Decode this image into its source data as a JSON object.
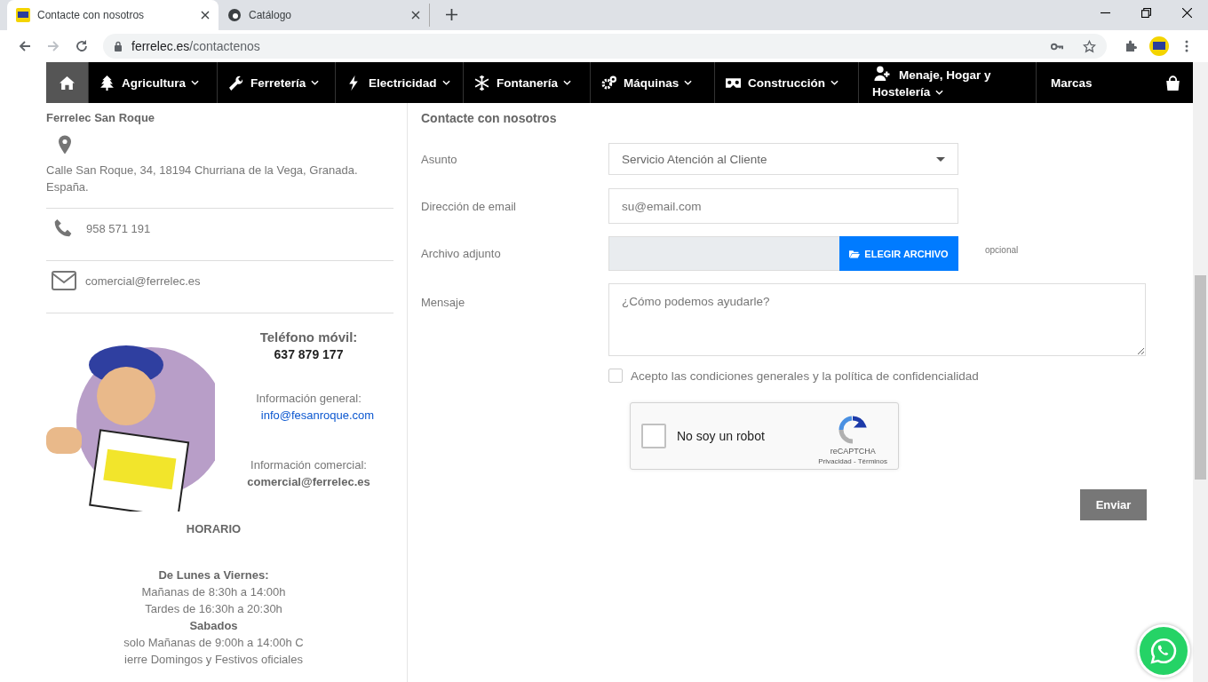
{
  "browser": {
    "tabs": [
      {
        "title": "Contacte con nosotros",
        "selected": true
      },
      {
        "title": "Catálogo",
        "selected": false
      }
    ],
    "url_host": "ferrelec.es",
    "url_path": "/contactenos"
  },
  "nav": {
    "items": [
      {
        "selected": true,
        "dropdown": false
      },
      {
        "label": "Agricultura",
        "selected": false,
        "dropdown": true
      },
      {
        "label": "Ferretería",
        "selected": false,
        "dropdown": true
      },
      {
        "label": "Electricidad",
        "selected": false,
        "dropdown": true
      },
      {
        "label": "Fontanería",
        "selected": false,
        "dropdown": true
      },
      {
        "label": "Máquinas",
        "selected": false,
        "dropdown": true
      },
      {
        "label": "Construcción",
        "selected": false,
        "dropdown": true
      },
      {
        "label": "Menaje, Hogar y Hostelería",
        "selected": false,
        "dropdown": true
      },
      {
        "label": "Marcas",
        "selected": false,
        "dropdown": false
      }
    ]
  },
  "contact_info": {
    "company": "Ferrelec San Roque",
    "address": "Calle San Roque, 34, 18194 Churriana de la Vega, Granada. España.",
    "phone": "958 571 191",
    "email": "comercial@ferrelec.es",
    "mobile_label": "Teléfono móvil:",
    "mobile": "637 879 177",
    "general_label": "Información general:",
    "general_email": "info@fesanroque.com",
    "commercial_label": "Información comercial:",
    "commercial_email": "comercial@ferrelec.es",
    "hours_title": "HORARIO",
    "hours": [
      {
        "text": "De Lunes a Viernes:",
        "kind": "heading"
      },
      {
        "text": "Mañanas de 8:30h a 14:00h",
        "kind": "line"
      },
      {
        "text": "Tardes de 16:30h a 20:30h",
        "kind": "line"
      },
      {
        "text": "Sabados",
        "kind": "heading"
      },
      {
        "text": "solo Mañanas de 9:00h a 14:00h C",
        "kind": "line"
      },
      {
        "text": "ierre Domingos y Festivos oficiales",
        "kind": "line"
      }
    ]
  },
  "form": {
    "title": "Contacte con nosotros",
    "fields": [
      {
        "label": "Asunto",
        "kind": "select",
        "value": "Servicio Atención al Cliente"
      },
      {
        "label": "Dirección de email",
        "kind": "input",
        "placeholder": "su@email.com"
      },
      {
        "label": "Archivo adjunto",
        "kind": "file",
        "button": "ELEGIR ARCHIVO",
        "note": "opcional"
      },
      {
        "label": "Mensaje",
        "kind": "textarea",
        "placeholder": "¿Cómo podemos ayudarle?"
      }
    ],
    "consent": {
      "label": "Acepto las condiciones generales y la política de confidencialidad",
      "checked": false
    },
    "captcha": {
      "label": "No soy un robot",
      "checked": false,
      "brand": "reCAPTCHA",
      "links": "Privacidad - Términos"
    },
    "submit": "Enviar"
  }
}
